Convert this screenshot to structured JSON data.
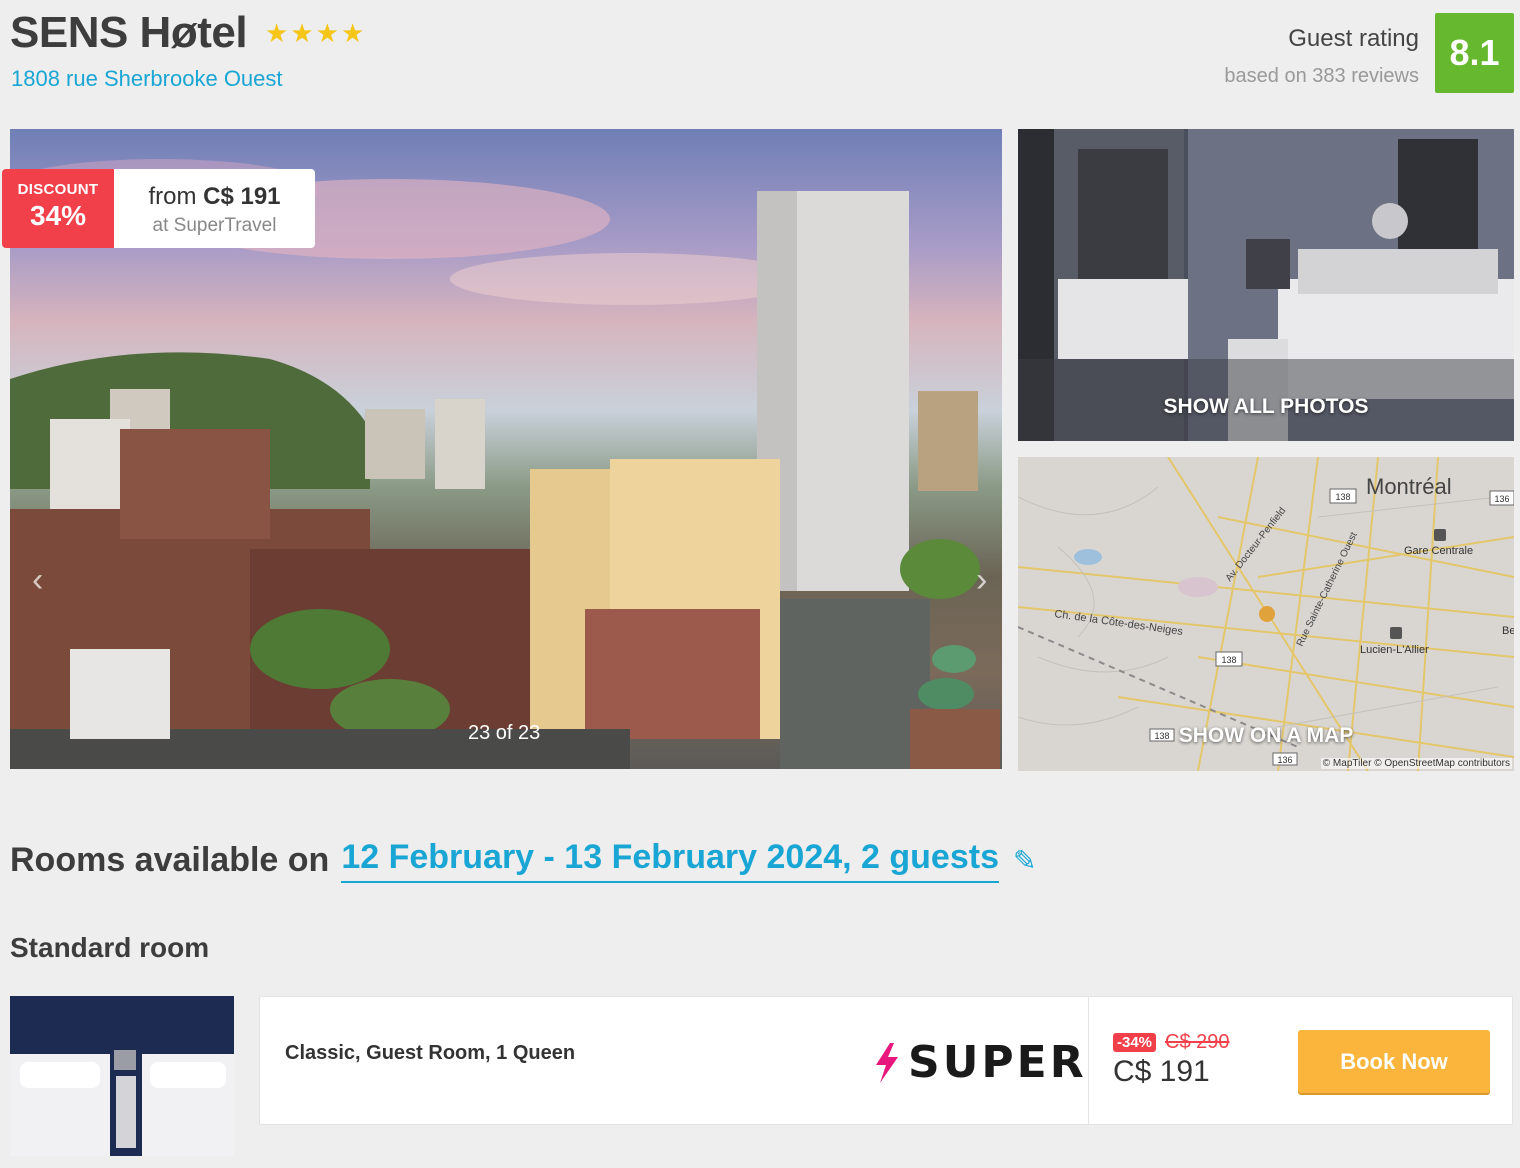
{
  "hotel": {
    "name": "SENS Høtel",
    "stars": 4,
    "star_glyph": "★",
    "address": "1808 rue Sherbrooke Ouest"
  },
  "rating": {
    "label": "Guest rating",
    "reviews": "based on 383 reviews",
    "score": "8.1",
    "color": "#66b82e"
  },
  "gallery": {
    "discount_label": "DISCOUNT",
    "discount_value": "34%",
    "price_from_prefix": "from",
    "price_from_value": "C$ 191",
    "price_source": "at SuperTravel",
    "counter": "23 of 23",
    "prev_icon": "‹",
    "next_icon": "›",
    "show_all_photos": "SHOW ALL PHOTOS",
    "show_on_map": "SHOW ON A MAP"
  },
  "map": {
    "city": "Montréal",
    "labels": [
      "Gare Centrale",
      "Lucien-L'Allier",
      "Ch. de la Côte-des-Neiges",
      "Av. Docteur-Penfield",
      "Rue Sainte-Catherine Ouest",
      "Be"
    ],
    "route_numbers": [
      "138",
      "136",
      "138",
      "138",
      "136"
    ],
    "attribution": "© MapTiler © OpenStreetMap contributors"
  },
  "rooms": {
    "heading_prefix": "Rooms available on",
    "dates": "12 February - 13 February 2024, 2 guests",
    "edit_icon": "✎",
    "room_type": "Standard room"
  },
  "offer": {
    "room_name": "Classic, Guest Room, 1 Queen",
    "provider": "SUPER",
    "discount": "-34%",
    "old_price": "C$ 290",
    "price": "C$ 191",
    "book_label": "Book Now",
    "accent_color": "#fbb53c",
    "discount_color": "#f1404a"
  }
}
